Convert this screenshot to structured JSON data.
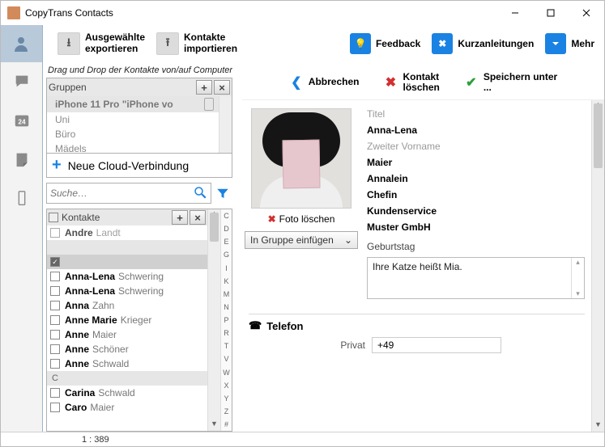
{
  "window": {
    "title": "CopyTrans Contacts"
  },
  "toolbar": {
    "export_label": "Ausgewählte\nexportieren",
    "import_label": "Kontakte\nimportieren",
    "feedback": "Feedback",
    "guides": "Kurzanleitungen",
    "more": "Mehr"
  },
  "edit_actions": {
    "cancel": "Abbrechen",
    "delete": "Kontakt\nlöschen",
    "save": "Speichern unter\n..."
  },
  "drag_hint": "Drag und Drop der Kontakte von/auf Computer",
  "groups": {
    "header": "Gruppen",
    "device": "iPhone 11 Pro \"iPhone vo",
    "items": [
      "Uni",
      "Büro",
      "Mädels"
    ]
  },
  "cloud_button": "Neue Cloud-Verbindung",
  "search": {
    "placeholder": "Suche…"
  },
  "contacts_header": "Kontakte",
  "alpha_index": [
    "C",
    "D",
    "E",
    "G",
    "I",
    "K",
    "M",
    "N",
    "P",
    "R",
    "T",
    "V",
    "W",
    "X",
    "Y",
    "Z",
    "#"
  ],
  "contacts": [
    {
      "first": "Andre",
      "last": "Landt",
      "cutTop": true
    },
    {
      "separator": " "
    },
    {
      "selected": true
    },
    {
      "first": "Anna-Lena",
      "last": "Schwering"
    },
    {
      "first": "Anna-Lena",
      "last": "Schwering"
    },
    {
      "first": "Anna",
      "last": "Zahn"
    },
    {
      "first": "Anne Marie",
      "last": "Krieger"
    },
    {
      "first": "Anne",
      "last": "Maier"
    },
    {
      "first": "Anne",
      "last": "Schöner"
    },
    {
      "first": "Anne",
      "last": "Schwald"
    },
    {
      "separator": "C"
    },
    {
      "first": "Carina",
      "last": "Schwald"
    },
    {
      "first": "Caro",
      "last": "Maier"
    }
  ],
  "photo_actions": {
    "delete": "Foto löschen",
    "group_select": "In Gruppe einfügen"
  },
  "contact_fields": [
    {
      "placeholder": "Titel"
    },
    {
      "value": "Anna-Lena"
    },
    {
      "placeholder": "Zweiter Vorname"
    },
    {
      "value": "Maier"
    },
    {
      "value": "Annalein"
    },
    {
      "value": "Chefin"
    },
    {
      "value": "Kundenservice"
    },
    {
      "value": "Muster GmbH"
    }
  ],
  "birthday_label": "Geburtstag",
  "note_text": "Ihre Katze heißt Mia.",
  "phone_section": {
    "header": "Telefon",
    "label": "Privat",
    "value": "+49"
  },
  "status": {
    "counter": "1 : 389"
  }
}
